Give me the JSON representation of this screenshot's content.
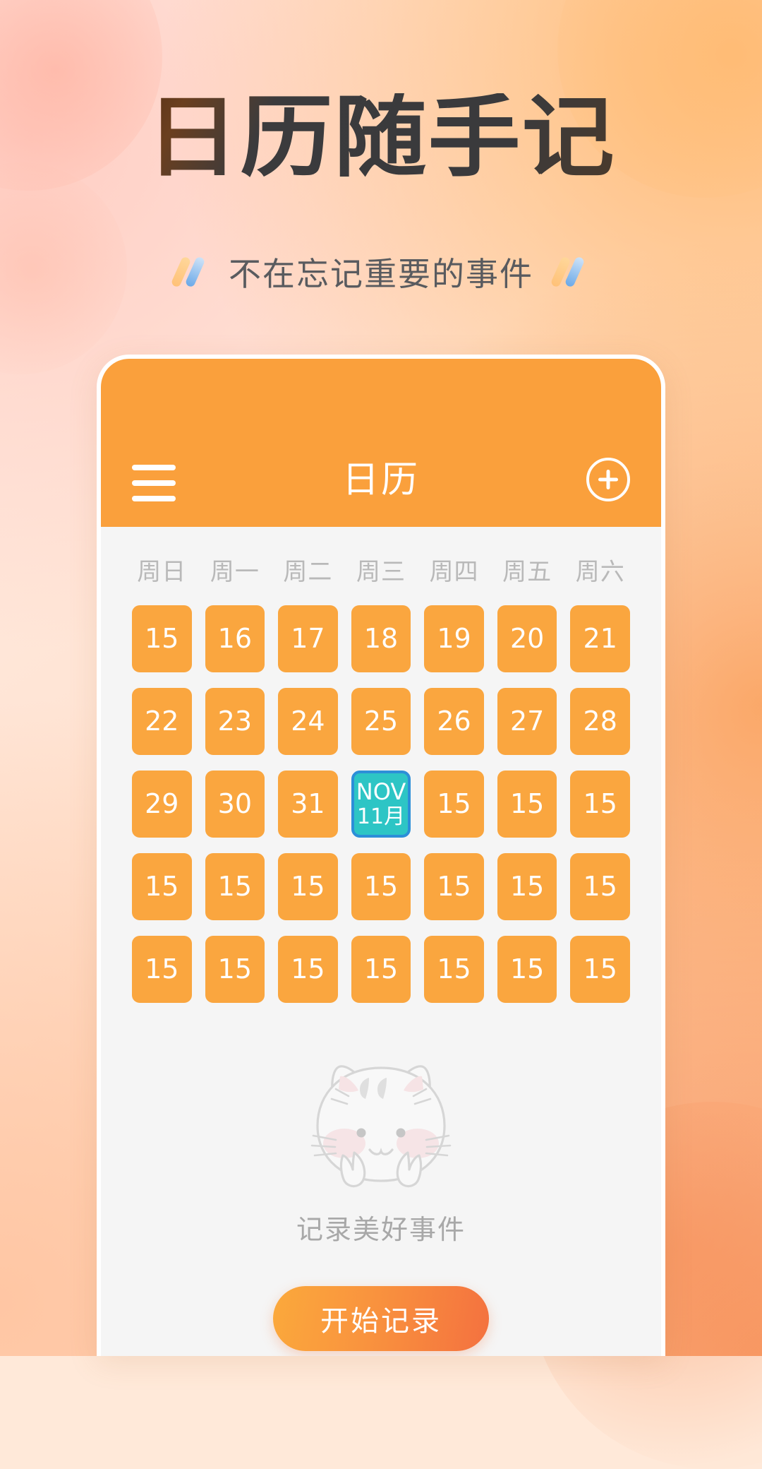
{
  "hero": {
    "title": "日历随手记",
    "subtitle": "不在忘记重要的事件",
    "title_color": "#3A3A3C",
    "subtitle_color": "#595B5F"
  },
  "app": {
    "accent_color": "#FAA03C",
    "appbar": {
      "menu_icon": "hamburger-menu-icon",
      "title": "日历",
      "add_icon": "plus-circle-icon"
    },
    "calendar": {
      "weekdays": [
        "周日",
        "周一",
        "周二",
        "周三",
        "周四",
        "周五",
        "周六"
      ],
      "day_color": "#FAA63F",
      "today_color": "#2DC5C5",
      "today_border_color": "#2C8FD8",
      "weeks": [
        [
          {
            "label": "15"
          },
          {
            "label": "16"
          },
          {
            "label": "17"
          },
          {
            "label": "18"
          },
          {
            "label": "19"
          },
          {
            "label": "20"
          },
          {
            "label": "21"
          }
        ],
        [
          {
            "label": "22"
          },
          {
            "label": "23"
          },
          {
            "label": "24"
          },
          {
            "label": "25"
          },
          {
            "label": "26"
          },
          {
            "label": "27"
          },
          {
            "label": "28"
          }
        ],
        [
          {
            "label": "29"
          },
          {
            "label": "30"
          },
          {
            "label": "31"
          },
          {
            "label": "NOV",
            "label2": "11月",
            "today": true
          },
          {
            "label": "15"
          },
          {
            "label": "15"
          },
          {
            "label": "15"
          }
        ],
        [
          {
            "label": "15"
          },
          {
            "label": "15"
          },
          {
            "label": "15"
          },
          {
            "label": "15"
          },
          {
            "label": "15"
          },
          {
            "label": "15"
          },
          {
            "label": "15"
          }
        ],
        [
          {
            "label": "15"
          },
          {
            "label": "15"
          },
          {
            "label": "15"
          },
          {
            "label": "15"
          },
          {
            "label": "15"
          },
          {
            "label": "15"
          },
          {
            "label": "15"
          }
        ]
      ]
    },
    "empty_state": {
      "illustration": "cat-illustration",
      "text": "记录美好事件"
    },
    "cta": {
      "label": "开始记录",
      "gradient_from": "#FBA93C",
      "gradient_to": "#F4713F"
    }
  }
}
